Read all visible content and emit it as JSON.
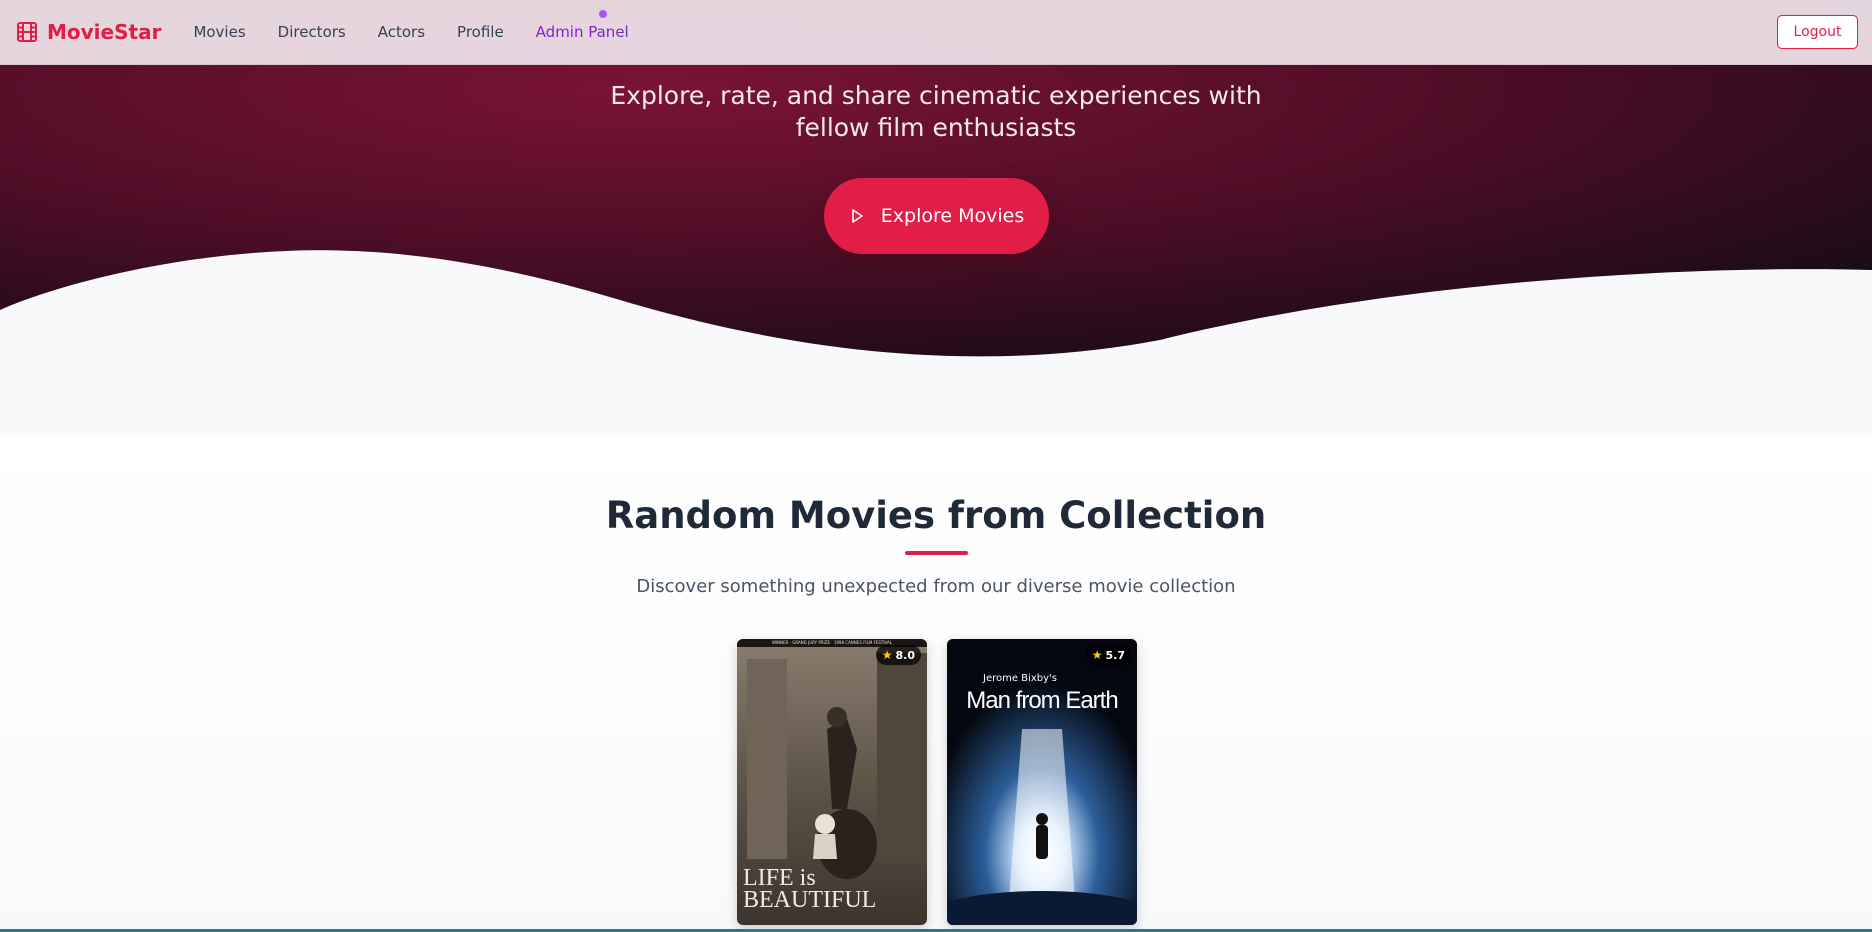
{
  "brand": {
    "name": "MovieStar",
    "icon": "film-icon"
  },
  "nav": {
    "items": [
      {
        "label": "Movies"
      },
      {
        "label": "Directors"
      },
      {
        "label": "Actors"
      },
      {
        "label": "Profile"
      },
      {
        "label": "Admin Panel"
      }
    ],
    "logout_label": "Logout"
  },
  "hero": {
    "subtitle": "Explore, rate, and share cinematic experiences with fellow film enthusiasts",
    "cta_label": "Explore Movies",
    "cta_icon": "play-icon"
  },
  "random_section": {
    "title": "Random Movies from Collection",
    "subtitle": "Discover something unexpected from our diverse movie collection",
    "movies": [
      {
        "rating": "8.0",
        "poster_title": "LIFE is BEAUTIFUL",
        "poster_banner": "WINNER · GRAND JURY PRIZE · 1998 CANNES FILM FESTIVAL"
      },
      {
        "rating": "5.7",
        "poster_title": "Man from Earth",
        "poster_credit": "Jerome Bixby's"
      }
    ]
  },
  "colors": {
    "accent": "#e11d48",
    "admin": "#7e22ce",
    "hero_dark": "#1a0f1a",
    "hero_wine": "#6b1030"
  }
}
